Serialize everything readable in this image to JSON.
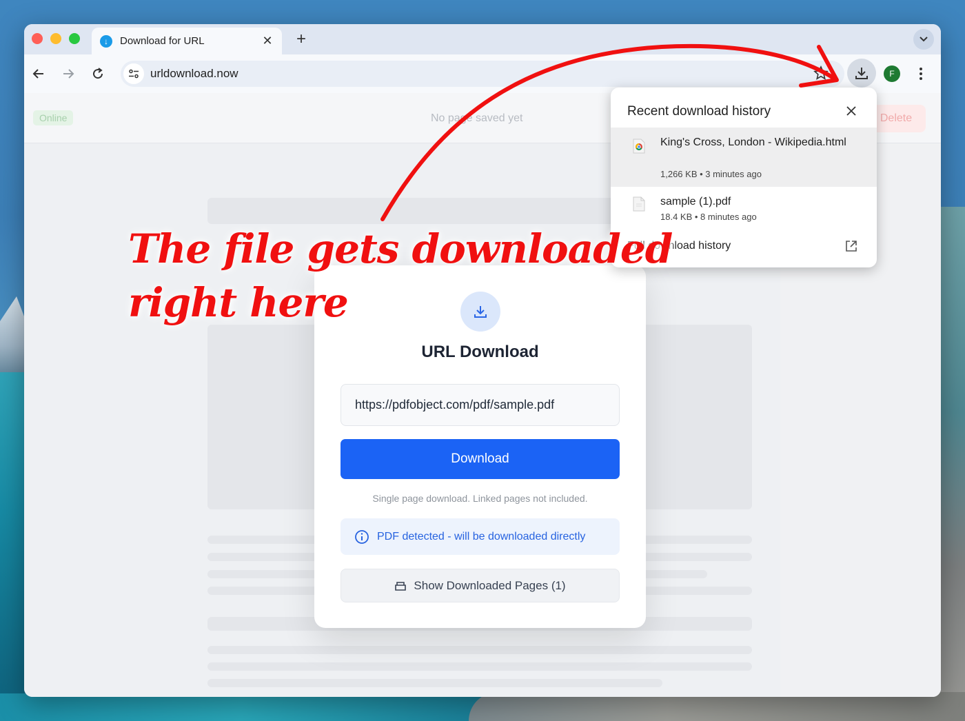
{
  "tab": {
    "title": "Download for URL"
  },
  "address_bar": {
    "url": "urldownload.now"
  },
  "toolbar": {
    "profile_initial": "F"
  },
  "page": {
    "status_badge": "Online",
    "status_text": "No page saved yet",
    "delete_label": "Delete"
  },
  "modal": {
    "title": "URL Download",
    "url_value": "https://pdfobject.com/pdf/sample.pdf",
    "download_label": "Download",
    "note": "Single page download. Linked pages not included.",
    "info_text": "PDF detected - will be downloaded directly",
    "show_pages_label": "Show Downloaded Pages (1)"
  },
  "download_bubble": {
    "title": "Recent download history",
    "items": [
      {
        "name": "King's Cross, London - Wikipedia.html",
        "meta": "1,266 KB • 3 minutes ago",
        "icon": "chrome-file-icon"
      },
      {
        "name": "sample (1).pdf",
        "meta": "18.4 KB • 8 minutes ago",
        "icon": "pdf-file-icon"
      }
    ],
    "footer_label": "Full download history"
  },
  "annotation": {
    "line1": "The file gets downloaded",
    "line2": "right here",
    "color": "#f01010"
  },
  "colors": {
    "accent": "#1b63f5",
    "info": "#2763e0"
  }
}
